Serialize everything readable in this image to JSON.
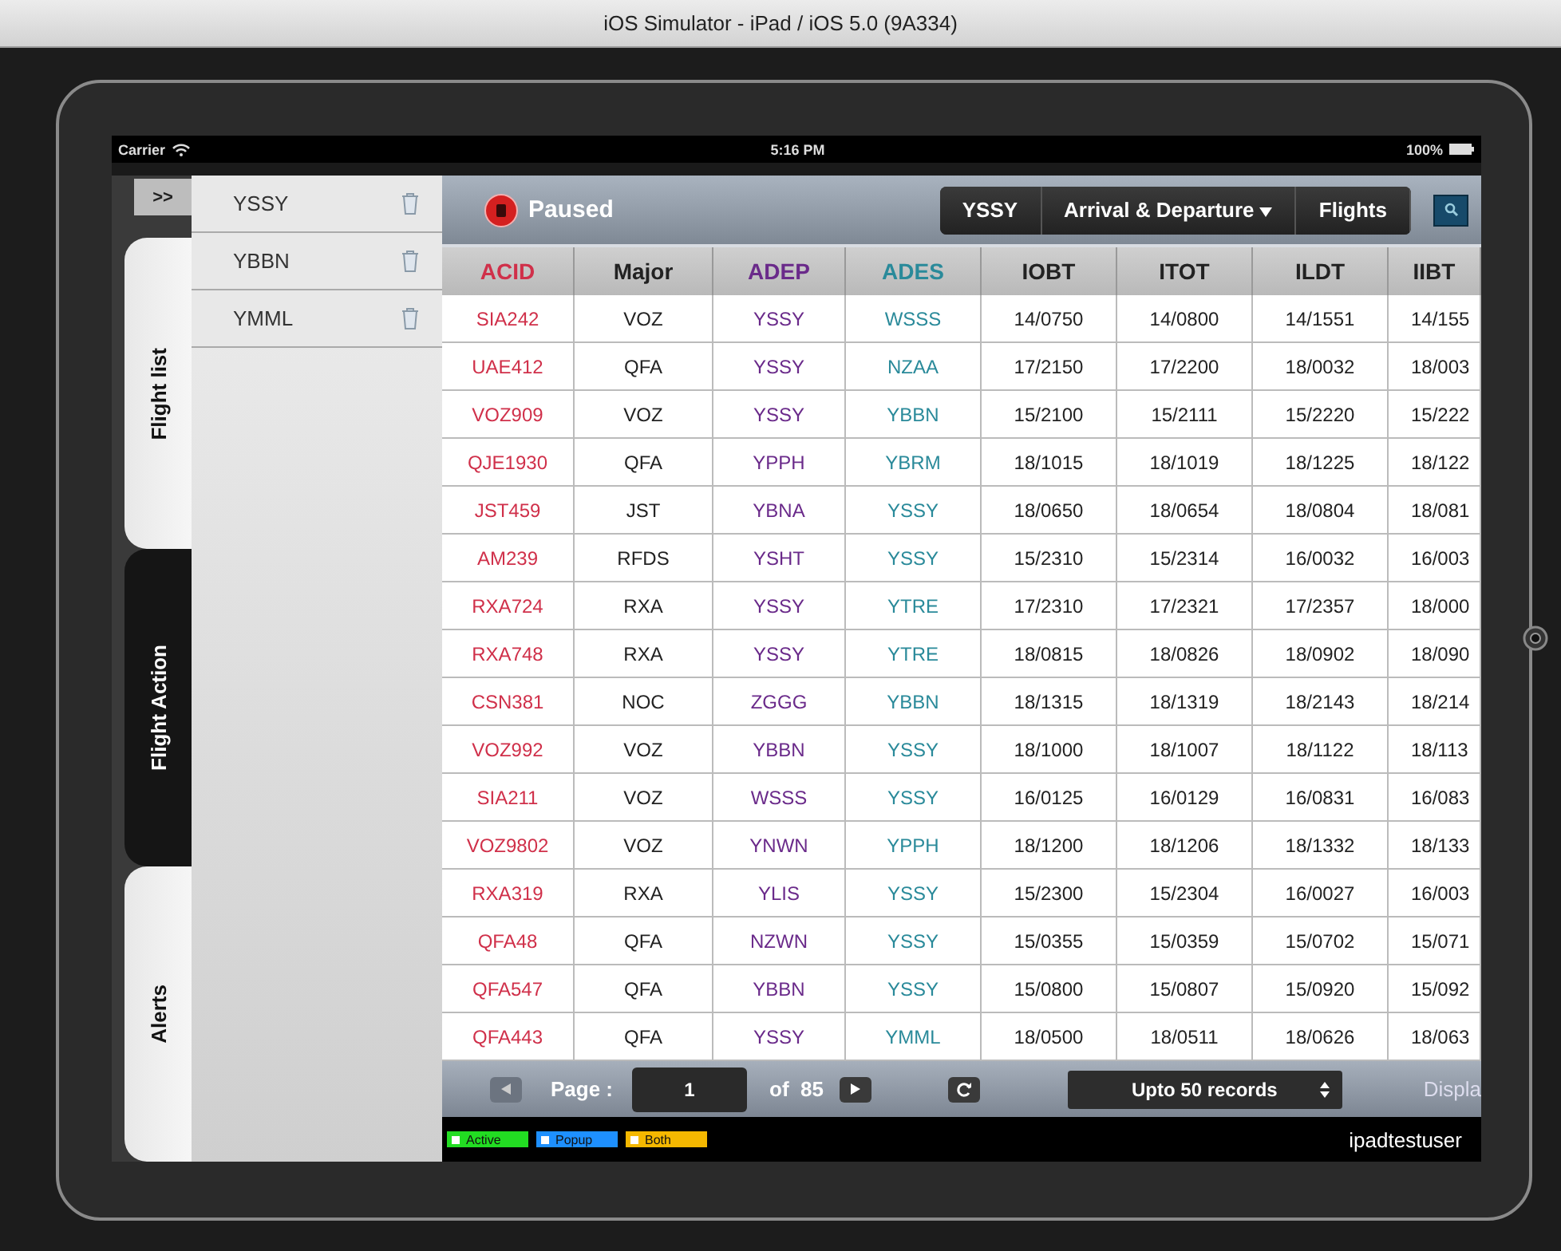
{
  "window": {
    "title": "iOS Simulator - iPad / iOS 5.0 (9A334)"
  },
  "status_bar": {
    "carrier": "Carrier",
    "time": "5:16 PM",
    "battery": "100%"
  },
  "side_toggle": ">>",
  "side_tabs": [
    {
      "label": "Flight list",
      "kind": "light"
    },
    {
      "label": "Flight Action",
      "kind": "dark"
    },
    {
      "label": "Alerts",
      "kind": "light"
    }
  ],
  "airports": [
    {
      "code": "YSSY"
    },
    {
      "code": "YBBN"
    },
    {
      "code": "YMML"
    }
  ],
  "toolbar": {
    "status": "Paused",
    "breadcrumb": [
      {
        "label": "YSSY",
        "dropdown": false
      },
      {
        "label": "Arrival & Departure",
        "dropdown": true
      },
      {
        "label": "Flights",
        "dropdown": false
      }
    ]
  },
  "table": {
    "columns": [
      {
        "label": "ACID",
        "color": "#d0304a"
      },
      {
        "label": "Major",
        "color": "#222222"
      },
      {
        "label": "ADEP",
        "color": "#6a2a8a"
      },
      {
        "label": "ADES",
        "color": "#2a8a9a"
      },
      {
        "label": "IOBT",
        "color": "#222222"
      },
      {
        "label": "ITOT",
        "color": "#222222"
      },
      {
        "label": "ILDT",
        "color": "#222222"
      },
      {
        "label": "IIBT",
        "color": "#222222"
      }
    ],
    "rows": [
      [
        "SIA242",
        "VOZ",
        "YSSY",
        "WSSS",
        "14/0750",
        "14/0800",
        "14/1551",
        "14/155"
      ],
      [
        "UAE412",
        "QFA",
        "YSSY",
        "NZAA",
        "17/2150",
        "17/2200",
        "18/0032",
        "18/003"
      ],
      [
        "VOZ909",
        "VOZ",
        "YSSY",
        "YBBN",
        "15/2100",
        "15/2111",
        "15/2220",
        "15/222"
      ],
      [
        "QJE1930",
        "QFA",
        "YPPH",
        "YBRM",
        "18/1015",
        "18/1019",
        "18/1225",
        "18/122"
      ],
      [
        "JST459",
        "JST",
        "YBNA",
        "YSSY",
        "18/0650",
        "18/0654",
        "18/0804",
        "18/081"
      ],
      [
        "AM239",
        "RFDS",
        "YSHT",
        "YSSY",
        "15/2310",
        "15/2314",
        "16/0032",
        "16/003"
      ],
      [
        "RXA724",
        "RXA",
        "YSSY",
        "YTRE",
        "17/2310",
        "17/2321",
        "17/2357",
        "18/000"
      ],
      [
        "RXA748",
        "RXA",
        "YSSY",
        "YTRE",
        "18/0815",
        "18/0826",
        "18/0902",
        "18/090"
      ],
      [
        "CSN381",
        "NOC",
        "ZGGG",
        "YBBN",
        "18/1315",
        "18/1319",
        "18/2143",
        "18/214"
      ],
      [
        "VOZ992",
        "VOZ",
        "YBBN",
        "YSSY",
        "18/1000",
        "18/1007",
        "18/1122",
        "18/113"
      ],
      [
        "SIA211",
        "VOZ",
        "WSSS",
        "YSSY",
        "16/0125",
        "16/0129",
        "16/0831",
        "16/083"
      ],
      [
        "VOZ9802",
        "VOZ",
        "YNWN",
        "YPPH",
        "18/1200",
        "18/1206",
        "18/1332",
        "18/133"
      ],
      [
        "RXA319",
        "RXA",
        "YLIS",
        "YSSY",
        "15/2300",
        "15/2304",
        "16/0027",
        "16/003"
      ],
      [
        "QFA48",
        "QFA",
        "NZWN",
        "YSSY",
        "15/0355",
        "15/0359",
        "15/0702",
        "15/071"
      ],
      [
        "QFA547",
        "QFA",
        "YBBN",
        "YSSY",
        "15/0800",
        "15/0807",
        "15/0920",
        "15/092"
      ],
      [
        "QFA443",
        "QFA",
        "YSSY",
        "YMML",
        "18/0500",
        "18/0511",
        "18/0626",
        "18/063"
      ]
    ]
  },
  "pager": {
    "label": "Page :",
    "page": "1",
    "of": "of  85",
    "page_size": "Upto 50 records",
    "display": "Displa"
  },
  "legend": [
    {
      "label": "Active",
      "color": "#22dd22"
    },
    {
      "label": "Popup",
      "color": "#1e90ff"
    },
    {
      "label": "Both",
      "color": "#f5b800"
    }
  ],
  "user": "ipadtestuser"
}
